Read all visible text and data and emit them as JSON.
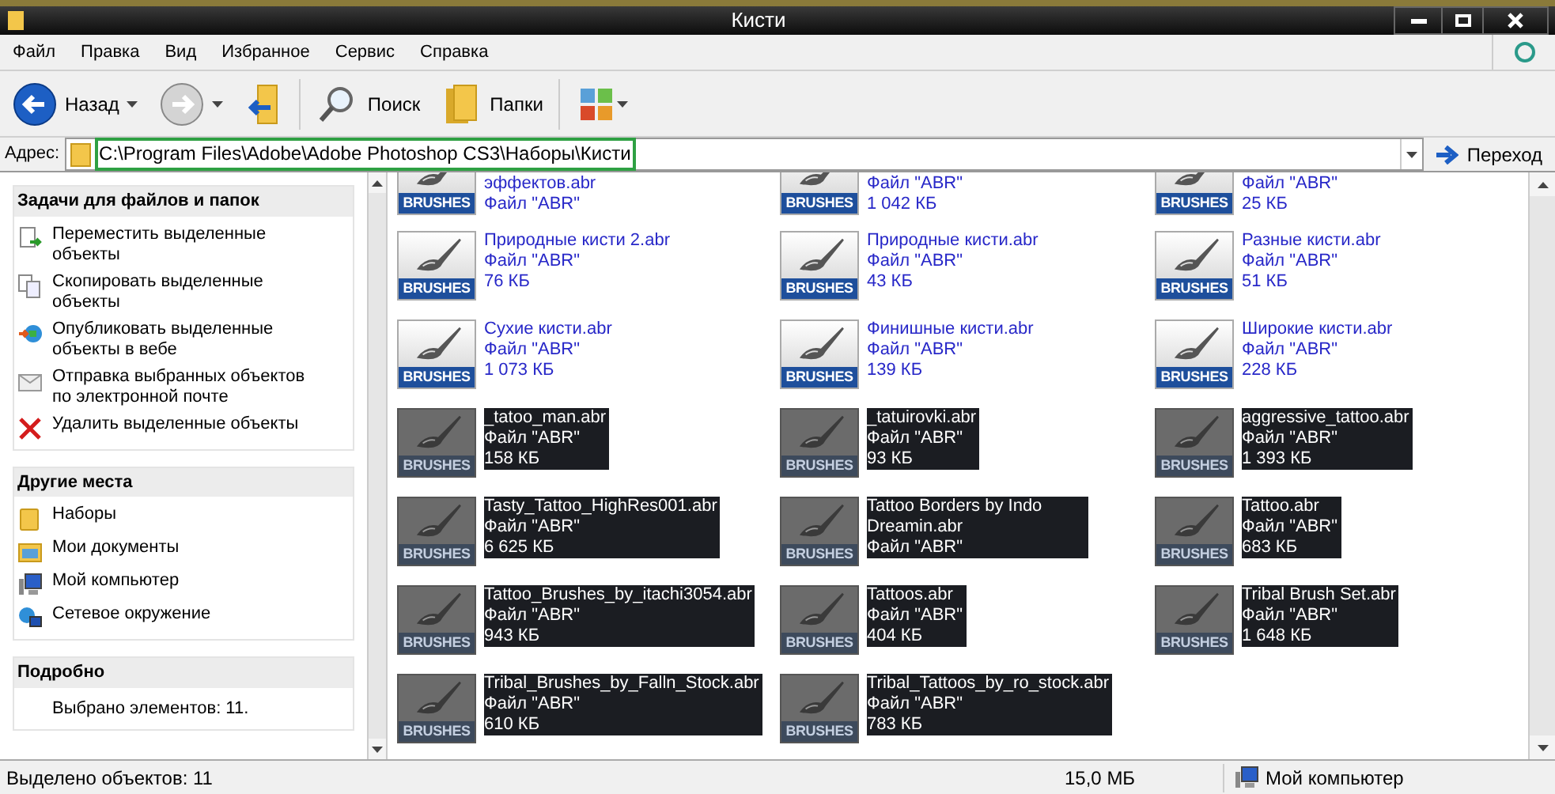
{
  "window": {
    "title": "Кисти"
  },
  "menu": [
    "Файл",
    "Правка",
    "Вид",
    "Избранное",
    "Сервис",
    "Справка"
  ],
  "toolbar": [
    {
      "kind": "back",
      "label": "Назад"
    },
    {
      "kind": "forward"
    },
    {
      "kind": "up"
    },
    {
      "kind": "search",
      "label": "Поиск"
    },
    {
      "kind": "folders",
      "label": "Папки"
    },
    {
      "kind": "views"
    }
  ],
  "address": {
    "label": "Адрес:",
    "value": "C:\\Program Files\\Adobe\\Adobe Photoshop CS3\\Наборы\\Кисти",
    "go": "Переход"
  },
  "sidebar": [
    {
      "title": "Задачи для файлов и папок",
      "items": [
        {
          "kind": "move",
          "label": "Переместить выделенные объекты"
        },
        {
          "kind": "copy",
          "label": "Скопировать выделенные объекты"
        },
        {
          "kind": "publish",
          "label": "Опубликовать выделенные объекты в вебе"
        },
        {
          "kind": "mail",
          "label": "Отправка выбранных объектов по электронной почте"
        },
        {
          "kind": "delete",
          "label": "Удалить выделенные объекты"
        }
      ]
    },
    {
      "title": "Другие места",
      "items": [
        {
          "kind": "folder",
          "label": "Наборы"
        },
        {
          "kind": "documents",
          "label": "Мои документы"
        },
        {
          "kind": "computer",
          "label": "Мой компьютер"
        },
        {
          "kind": "network",
          "label": "Сетевое окружение"
        }
      ]
    },
    {
      "title": "Подробно",
      "items": [
        {
          "kind": "text",
          "label": "Выбрано элементов: 11."
        }
      ]
    }
  ],
  "cut_row": [
    {
      "icon_label": "BRUSHES",
      "selected": false,
      "lines": [
        "эффектов.abr",
        "Файл \"ABR\""
      ]
    },
    {
      "icon_label": "BRUSHES",
      "selected": false,
      "lines": [
        "Файл \"ABR\"",
        "1 042 КБ"
      ]
    },
    {
      "icon_label": "BRUSHES",
      "selected": false,
      "lines": [
        "Файл \"ABR\"",
        "25 КБ"
      ]
    }
  ],
  "files": [
    {
      "icon_label": "BRUSHES",
      "selected": false,
      "lines": [
        "Природные кисти 2.abr",
        "Файл \"ABR\"",
        "76 КБ"
      ]
    },
    {
      "icon_label": "BRUSHES",
      "selected": false,
      "lines": [
        "Природные кисти.abr",
        "Файл \"ABR\"",
        "43 КБ"
      ]
    },
    {
      "icon_label": "BRUSHES",
      "selected": false,
      "lines": [
        "Разные кисти.abr",
        "Файл \"ABR\"",
        "51 КБ"
      ]
    },
    {
      "icon_label": "BRUSHES",
      "selected": false,
      "lines": [
        "Сухие кисти.abr",
        "Файл \"ABR\"",
        "1 073 КБ"
      ]
    },
    {
      "icon_label": "BRUSHES",
      "selected": false,
      "lines": [
        "Финишные кисти.abr",
        "Файл \"ABR\"",
        "139 КБ"
      ]
    },
    {
      "icon_label": "BRUSHES",
      "selected": false,
      "lines": [
        "Широкие кисти.abr",
        "Файл \"ABR\"",
        "228 КБ"
      ]
    },
    {
      "icon_label": "BRUSHES",
      "selected": true,
      "lines": [
        "_tatoo_man.abr",
        "Файл \"ABR\"",
        "158 КБ"
      ]
    },
    {
      "icon_label": "BRUSHES",
      "selected": true,
      "lines": [
        "_tatuirovki.abr",
        "Файл \"ABR\"",
        "93 КБ"
      ]
    },
    {
      "icon_label": "BRUSHES",
      "selected": true,
      "lines": [
        "aggressive_tattoo.abr",
        "Файл \"ABR\"",
        "1 393 КБ"
      ]
    },
    {
      "icon_label": "BRUSHES",
      "selected": true,
      "lines": [
        "Tasty_Tattoo_HighRes001.abr",
        "Файл \"ABR\"",
        "6 625 КБ"
      ]
    },
    {
      "icon_label": "BRUSHES",
      "selected": true,
      "lines": [
        "Tattoo Borders by Indo Dreamin.abr",
        "Файл \"ABR\""
      ]
    },
    {
      "icon_label": "BRUSHES",
      "selected": true,
      "lines": [
        "Tattoo.abr",
        "Файл \"ABR\"",
        "683 КБ"
      ]
    },
    {
      "icon_label": "BRUSHES",
      "selected": true,
      "lines": [
        "Tattoo_Brushes_by_itachi3054.abr",
        "Файл \"ABR\"",
        "943 КБ"
      ]
    },
    {
      "icon_label": "BRUSHES",
      "selected": true,
      "lines": [
        "Tattoos.abr",
        "Файл \"ABR\"",
        "404 КБ"
      ]
    },
    {
      "icon_label": "BRUSHES",
      "selected": true,
      "lines": [
        "Tribal Brush Set.abr",
        "Файл \"ABR\"",
        "1 648 КБ"
      ]
    },
    {
      "icon_label": "BRUSHES",
      "selected": true,
      "lines": [
        "Tribal_Brushes_by_Falln_Stock.abr",
        "Файл \"ABR\"",
        "610 КБ"
      ]
    },
    {
      "icon_label": "BRUSHES",
      "selected": true,
      "lines": [
        "Tribal_Tattoos_by_ro_stock.abr",
        "Файл \"ABR\"",
        "783 КБ"
      ]
    }
  ],
  "status_bar": {
    "text": "Выделено объектов: 11",
    "size": "15,0 МБ",
    "zone": "Мой компьютер"
  }
}
